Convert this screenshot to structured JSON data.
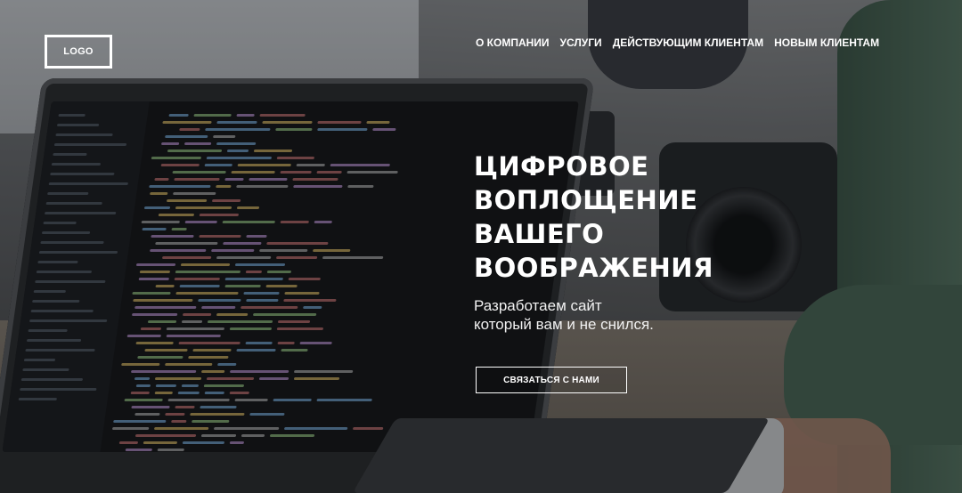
{
  "header": {
    "logo_label": "LOGO",
    "nav": [
      {
        "label": "О КОМПАНИИ"
      },
      {
        "label": "УСЛУГИ"
      },
      {
        "label": "ДЕЙСТВУЮЩИМ КЛИЕНТАМ"
      },
      {
        "label": "НОВЫМ КЛИЕНТАМ"
      }
    ]
  },
  "hero": {
    "headline_lines": [
      "ЦИФРОВОЕ",
      "ВОПЛОЩЕНИЕ",
      "ВАШЕГО",
      "ВООБРАЖЕНИЯ"
    ],
    "tagline_lines": [
      "Разработаем сайт",
      "который вам и не снился."
    ],
    "cta_label": "СВЯЗАТЬСЯ С НАМИ"
  },
  "colors": {
    "text": "#ffffff",
    "overlay": "#0a0c10"
  }
}
